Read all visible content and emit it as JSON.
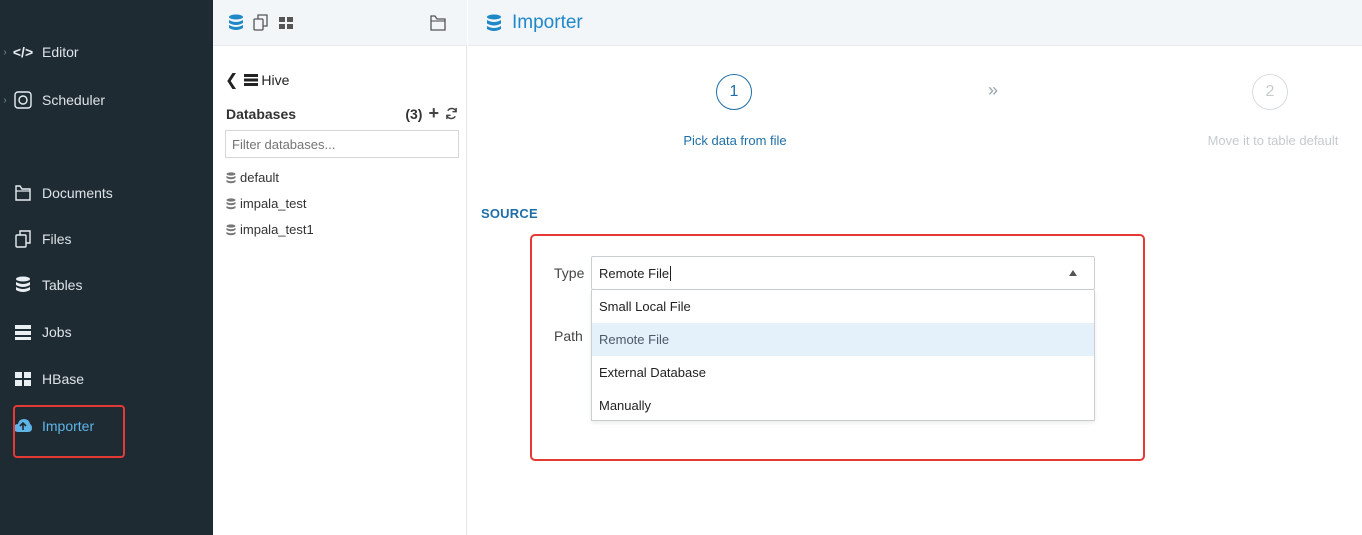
{
  "sidebar": {
    "items": [
      {
        "label": "Editor",
        "icon": "code-icon"
      },
      {
        "label": "Scheduler",
        "icon": "scheduler-icon"
      },
      {
        "label": "Documents",
        "icon": "documents-icon"
      },
      {
        "label": "Files",
        "icon": "files-icon"
      },
      {
        "label": "Tables",
        "icon": "database-icon"
      },
      {
        "label": "Jobs",
        "icon": "jobs-icon"
      },
      {
        "label": "HBase",
        "icon": "grid-icon"
      },
      {
        "label": "Importer",
        "icon": "cloud-upload-icon"
      }
    ]
  },
  "assist": {
    "back_label": "Hive",
    "databases_title": "Databases",
    "databases_count": "(3)",
    "filter_placeholder": "Filter databases...",
    "databases": [
      "default",
      "impala_test",
      "impala_test1"
    ]
  },
  "main": {
    "title": "Importer",
    "steps": [
      {
        "number": "1",
        "label": "Pick data from file"
      },
      {
        "number": "2",
        "label": "Move it to table default"
      }
    ],
    "step_separator": "»",
    "source_heading": "SOURCE",
    "type_label": "Type",
    "path_label": "Path",
    "type_value": "Remote File",
    "type_options": [
      "Small Local File",
      "Remote File",
      "External Database",
      "Manually"
    ]
  },
  "colors": {
    "sidebar_bg": "#1f2b33",
    "accent": "#1e88c8",
    "highlight_box": "#e53935",
    "selected_option_bg": "#e4f1fa"
  }
}
